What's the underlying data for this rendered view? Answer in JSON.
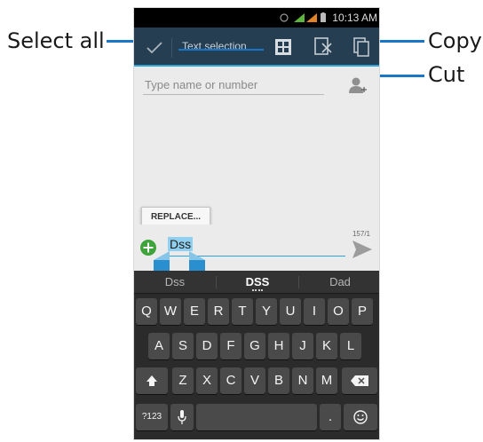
{
  "callouts": {
    "select_all": "Select all",
    "copy": "Copy",
    "cut": "Cut"
  },
  "status_bar": {
    "time": "10:13 AM"
  },
  "action_bar": {
    "title": "Text selection",
    "icons": [
      "check-icon",
      "select-all-icon",
      "cut-icon",
      "copy-icon"
    ]
  },
  "compose": {
    "recipient_placeholder": "Type name or number",
    "replace_label": "REPLACE...",
    "char_counter": "157/1",
    "message_text": "Dss"
  },
  "keyboard": {
    "suggestions": [
      "Dss",
      "DSS",
      "Dad"
    ],
    "row1": [
      "Q",
      "W",
      "E",
      "R",
      "T",
      "Y",
      "U",
      "I",
      "O",
      "P"
    ],
    "row2": [
      "A",
      "S",
      "D",
      "F",
      "G",
      "H",
      "J",
      "K",
      "L"
    ],
    "row3": [
      "Z",
      "X",
      "C",
      "V",
      "B",
      "N",
      "M"
    ],
    "symbols_label": "?123",
    "period_label": "."
  },
  "colors": {
    "callout_line": "#1877c9",
    "action_bar_bg": "#253e52",
    "accent": "#2ea3d8",
    "keyboard_bg": "#2b2b2b",
    "key_bg": "#4a4a4a",
    "add_button": "#3ea33a"
  }
}
